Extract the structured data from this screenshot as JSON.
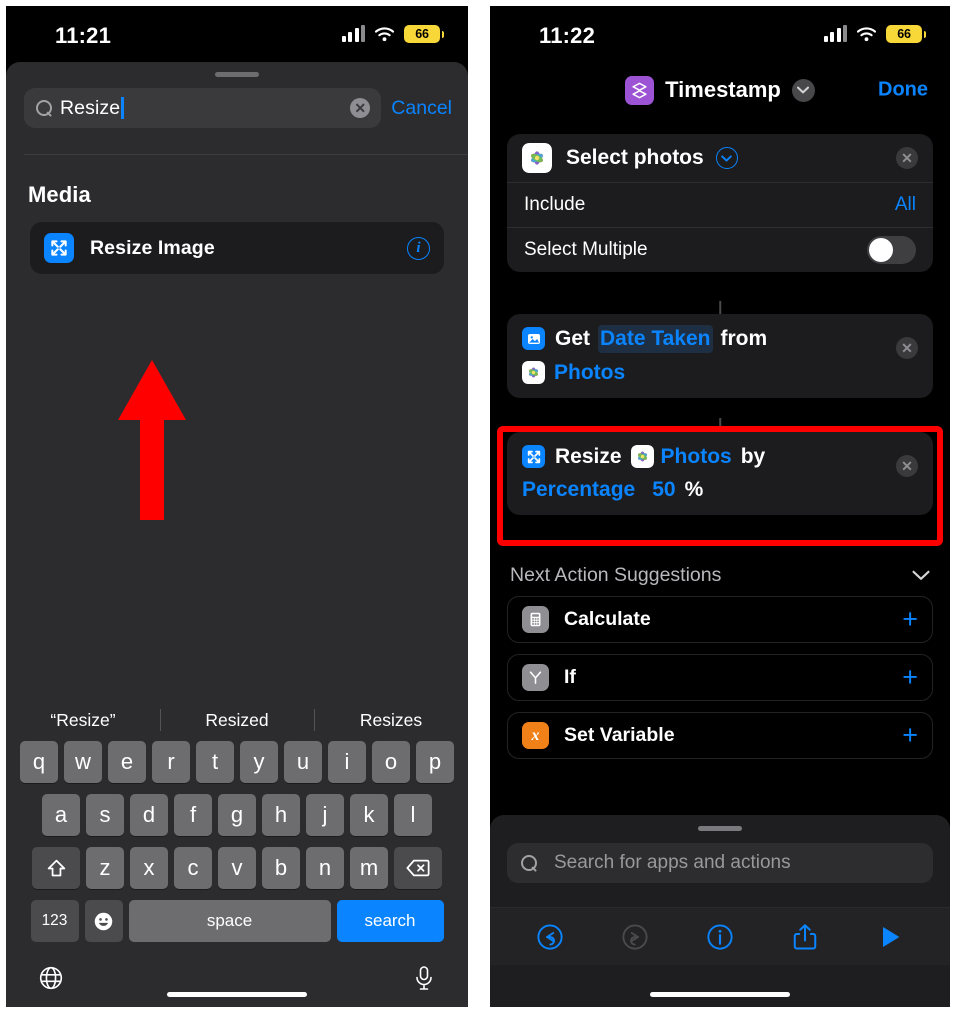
{
  "left_phone": {
    "status": {
      "time": "11:21",
      "battery": "66",
      "signal_icon": "cellular-bars-icon",
      "wifi_icon": "wifi-icon"
    },
    "search": {
      "value": "Resize",
      "clear_icon": "clear-circle-icon",
      "search_icon": "search-icon",
      "cancel_label": "Cancel"
    },
    "section_header": "Media",
    "results": [
      {
        "label": "Resize Image",
        "icon": "resize-image-icon",
        "info_icon": "info-circle-icon"
      }
    ],
    "annotation": {
      "shape": "red-up-arrow",
      "color": "#fe0000"
    },
    "keyboard": {
      "predictions": [
        "“Resize”",
        "Resized",
        "Resizes"
      ],
      "row1": [
        "q",
        "w",
        "e",
        "r",
        "t",
        "y",
        "u",
        "i",
        "o",
        "p"
      ],
      "row2": [
        "a",
        "s",
        "d",
        "f",
        "g",
        "h",
        "j",
        "k",
        "l"
      ],
      "row3": [
        "z",
        "x",
        "c",
        "v",
        "b",
        "n",
        "m"
      ],
      "shift_icon": "shift-up-icon",
      "backspace_icon": "backspace-icon",
      "numbers_label": "123",
      "emoji_icon": "emoji-smiley-icon",
      "space_label": "space",
      "return_label": "search",
      "globe_icon": "globe-icon",
      "mic_icon": "microphone-icon"
    }
  },
  "right_phone": {
    "status": {
      "time": "11:22",
      "battery": "66",
      "signal_icon": "cellular-bars-icon",
      "wifi_icon": "wifi-icon"
    },
    "nav": {
      "title": "Timestamp",
      "icon": "shortcuts-stack-icon",
      "chevron_icon": "chevron-down-icon",
      "done_label": "Done"
    },
    "actions": [
      {
        "title": "Select photos",
        "icon": "photos-app-icon",
        "expand_icon": "chevron-down-circle-icon",
        "remove_icon": "remove-x-icon",
        "params": [
          {
            "label": "Include",
            "value": "All",
            "type": "value"
          },
          {
            "label": "Select Multiple",
            "value": "off",
            "type": "toggle"
          }
        ]
      }
    ],
    "flow_actions": [
      {
        "id": "get-date-taken",
        "icon": "get-details-image-icon",
        "remove_icon": "remove-x-icon",
        "tokens": [
          {
            "text": "Get",
            "style": "plain"
          },
          {
            "text": "Date Taken",
            "style": "variable"
          },
          {
            "text": "from",
            "style": "plain"
          },
          {
            "text": "Photos",
            "style": "blue",
            "icon": "photos-app-icon"
          }
        ]
      },
      {
        "id": "resize-image",
        "icon": "resize-image-icon",
        "remove_icon": "remove-x-icon",
        "highlighted": true,
        "tokens": [
          {
            "text": "Resize",
            "style": "plain"
          },
          {
            "text": "Photos",
            "style": "blue",
            "icon": "photos-app-icon"
          },
          {
            "text": "by",
            "style": "plain"
          },
          {
            "text": "Percentage",
            "style": "blue"
          },
          {
            "text": "50",
            "style": "blue"
          },
          {
            "text": "%",
            "style": "plain"
          }
        ]
      }
    ],
    "suggestions": {
      "header": "Next Action Suggestions",
      "collapse_icon": "chevron-down-icon",
      "items": [
        {
          "label": "Calculate",
          "icon": "calculator-icon",
          "icon_color": "#8e8e93",
          "add_icon": "plus-icon"
        },
        {
          "label": "If",
          "icon": "if-branch-icon",
          "icon_color": "#8e8e93",
          "add_icon": "plus-icon"
        },
        {
          "label": "Set Variable",
          "icon": "set-variable-x-icon",
          "icon_color": "#f08018",
          "add_icon": "plus-icon"
        }
      ]
    },
    "bottom": {
      "search_placeholder": "Search for apps and actions",
      "search_icon": "search-icon",
      "toolbar": [
        {
          "name": "undo-icon",
          "state": "enabled"
        },
        {
          "name": "redo-icon",
          "state": "disabled"
        },
        {
          "name": "info-icon",
          "state": "enabled"
        },
        {
          "name": "share-icon",
          "state": "enabled"
        },
        {
          "name": "play-icon",
          "state": "enabled"
        }
      ]
    }
  },
  "colors": {
    "accent_blue": "#0a84ff",
    "highlight_red": "#fe0000",
    "battery_yellow": "#f8d738",
    "purple": "#9c54d5",
    "orange": "#f08018"
  }
}
